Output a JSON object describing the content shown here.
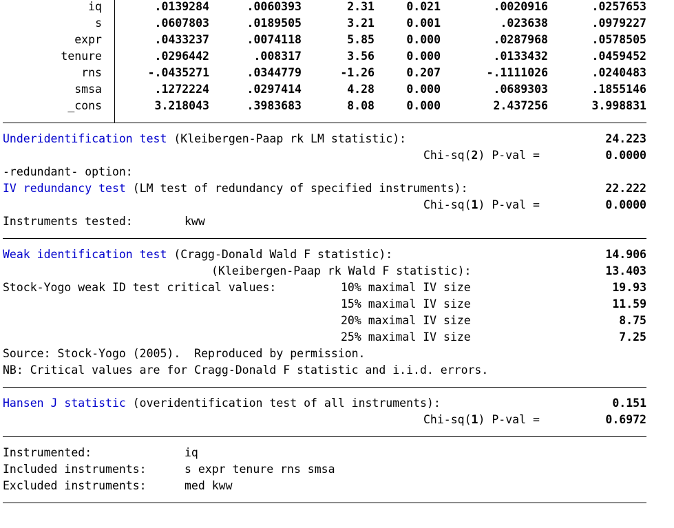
{
  "coef_rows": [
    {
      "var": "iq",
      "coef": ".0139284",
      "se": ".0060393",
      "z": "2.31",
      "p": "0.021",
      "lo": ".0020916",
      "hi": ".0257653"
    },
    {
      "var": "s",
      "coef": ".0607803",
      "se": ".0189505",
      "z": "3.21",
      "p": "0.001",
      "lo": ".023638",
      "hi": ".0979227"
    },
    {
      "var": "expr",
      "coef": ".0433237",
      "se": ".0074118",
      "z": "5.85",
      "p": "0.000",
      "lo": ".0287968",
      "hi": ".0578505"
    },
    {
      "var": "tenure",
      "coef": ".0296442",
      "se": ".008317",
      "z": "3.56",
      "p": "0.000",
      "lo": ".0133432",
      "hi": ".0459452"
    },
    {
      "var": "rns",
      "coef": "-.0435271",
      "se": ".0344779",
      "z": "-1.26",
      "p": "0.207",
      "lo": "-.1111026",
      "hi": ".0240483"
    },
    {
      "var": "smsa",
      "coef": ".1272224",
      "se": ".0297414",
      "z": "4.28",
      "p": "0.000",
      "lo": ".0689303",
      "hi": ".1855146"
    },
    {
      "var": "_cons",
      "coef": "3.218043",
      "se": ".3983683",
      "z": "8.08",
      "p": "0.000",
      "lo": "2.437256",
      "hi": "3.998831"
    }
  ],
  "underid": {
    "label": "Underidentification test",
    "desc": " (Kleibergen-Paap rk LM statistic):",
    "stat": "24.223",
    "chisq_prefix": "Chi-sq(",
    "df": "2",
    "chisq_suffix": ") P-val =",
    "pval": "0.0000"
  },
  "redundant": {
    "option_line": "-redundant- option:",
    "label": "IV redundancy test",
    "desc": " (LM test of redundancy of specified instruments):",
    "stat": "22.222",
    "chisq_prefix": "Chi-sq(",
    "df": "1",
    "chisq_suffix": ") P-val =",
    "pval": "0.0000",
    "tested_label": "Instruments tested:",
    "tested_value": "kww"
  },
  "weakid": {
    "label": "Weak identification test",
    "desc1": " (Cragg-Donald Wald F statistic):",
    "stat1": "14.906",
    "desc2": "(Kleibergen-Paap rk Wald F statistic):",
    "stat2": "13.403",
    "sy_label": "Stock-Yogo weak ID test critical values:",
    "critical": [
      {
        "label": "10% maximal IV size",
        "value": "19.93"
      },
      {
        "label": "15% maximal IV size",
        "value": "11.59"
      },
      {
        "label": "20% maximal IV size",
        "value": "8.75"
      },
      {
        "label": "25% maximal IV size",
        "value": "7.25"
      }
    ],
    "source": "Source: Stock-Yogo (2005).  Reproduced by permission.",
    "nb": "NB: Critical values are for Cragg-Donald F statistic and i.i.d. errors."
  },
  "hansen": {
    "label": "Hansen J statistic",
    "desc": " (overidentification test of all instruments):",
    "stat": "0.151",
    "chisq_prefix": "Chi-sq(",
    "df": "1",
    "chisq_suffix": ") P-val =",
    "pval": "0.6972"
  },
  "instruments": {
    "instrumented_label": "Instrumented:",
    "instrumented_value": "iq",
    "included_label": "Included instruments:",
    "included_value": "s expr tenure rns smsa",
    "excluded_label": "Excluded instruments:",
    "excluded_value": "med kww"
  },
  "colors": {
    "link_blue": "#0000cc",
    "text": "#000000",
    "background": "#ffffff"
  }
}
